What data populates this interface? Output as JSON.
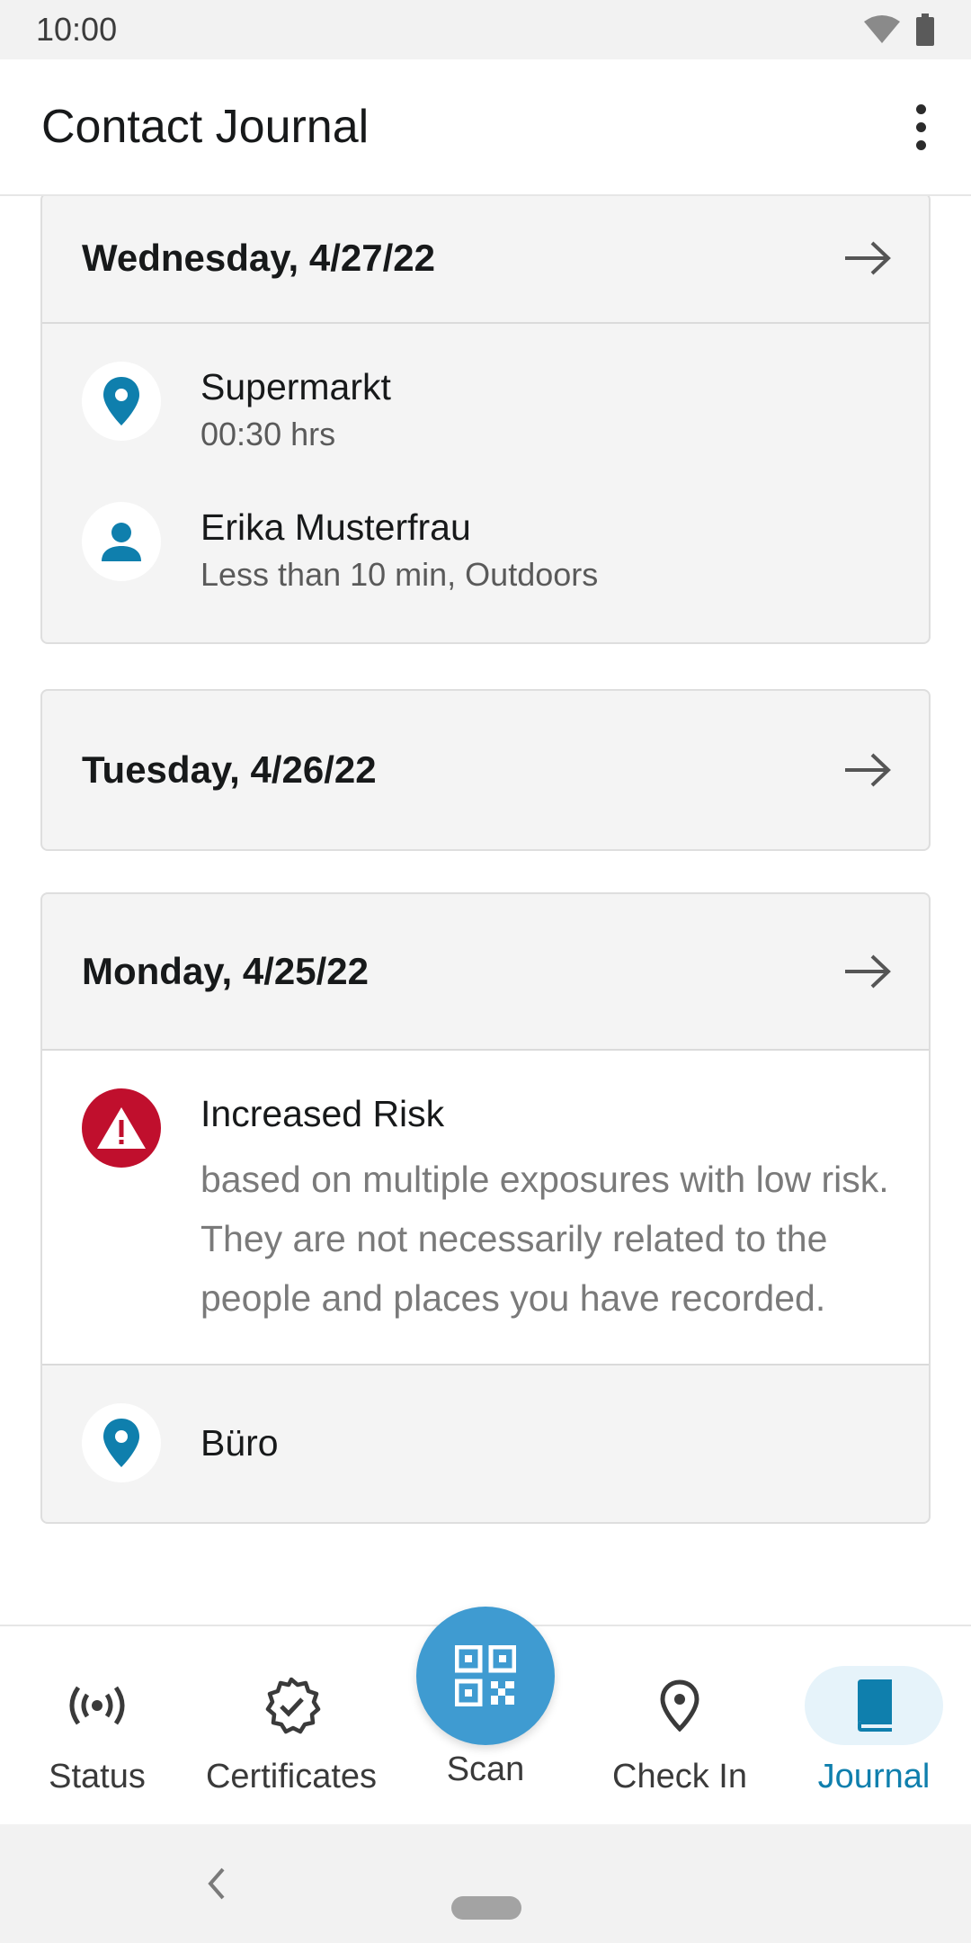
{
  "status_bar": {
    "time": "10:00"
  },
  "app_bar": {
    "title": "Contact Journal"
  },
  "days": [
    {
      "date": "Wednesday, 4/27/22",
      "entries": [
        {
          "type": "location",
          "title": "Supermarkt",
          "subtitle": "00:30 hrs"
        },
        {
          "type": "person",
          "title": "Erika Musterfrau",
          "subtitle": "Less than 10 min, Outdoors"
        }
      ]
    },
    {
      "date": "Tuesday, 4/26/22"
    },
    {
      "date": "Monday, 4/25/22",
      "risk": {
        "title": "Increased Risk",
        "line1": "based on multiple exposures with low risk.",
        "line2": "They are not necessarily related to the people and places you have recorded."
      },
      "entries": [
        {
          "type": "location",
          "title": "Büro"
        }
      ]
    }
  ],
  "bottom_nav": {
    "items": [
      {
        "label": "Status",
        "icon": "status-broadcast-icon"
      },
      {
        "label": "Certificates",
        "icon": "certificate-badge-icon"
      },
      {
        "label": "Scan",
        "icon": "qr-code-icon"
      },
      {
        "label": "Check In",
        "icon": "location-pin-icon"
      },
      {
        "label": "Journal",
        "icon": "journal-book-icon",
        "active": true
      }
    ]
  },
  "colors": {
    "accent": "#0f7fad",
    "scan_button": "#3f9bd1",
    "risk_red": "#c00f2d",
    "card_bg": "#f4f4f4",
    "active_nav_bg": "#e6f3fa"
  }
}
